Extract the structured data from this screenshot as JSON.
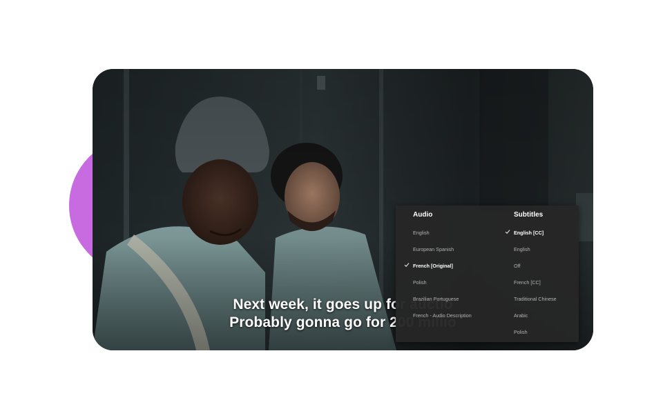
{
  "player": {
    "subtitle_line1": "Next week, it goes up for auctio",
    "subtitle_line2": "Probably gonna go for 200 millio"
  },
  "menu": {
    "audio": {
      "title": "Audio",
      "options": [
        {
          "label": "English",
          "selected": false
        },
        {
          "label": "European Spanish",
          "selected": false
        },
        {
          "label": "French [Original]",
          "selected": true
        },
        {
          "label": "Polish",
          "selected": false
        },
        {
          "label": "Brazilian Portuguese",
          "selected": false
        },
        {
          "label": "French - Audio Description",
          "selected": false
        }
      ]
    },
    "subtitles": {
      "title": "Subtitles",
      "options": [
        {
          "label": "English [CC]",
          "selected": true
        },
        {
          "label": "English",
          "selected": false
        },
        {
          "label": "Off",
          "selected": false
        },
        {
          "label": "French [CC]",
          "selected": false
        },
        {
          "label": "Traditional Chinese",
          "selected": false
        },
        {
          "label": "Arabic",
          "selected": false
        },
        {
          "label": "Polish",
          "selected": false
        }
      ]
    }
  },
  "colors": {
    "accent_circle": "#c86ae0",
    "menu_background": "#262626",
    "selected_text": "#ffffff",
    "unselected_text": "#b3b3b3"
  },
  "icons": {
    "selected_marker": "check-icon"
  }
}
